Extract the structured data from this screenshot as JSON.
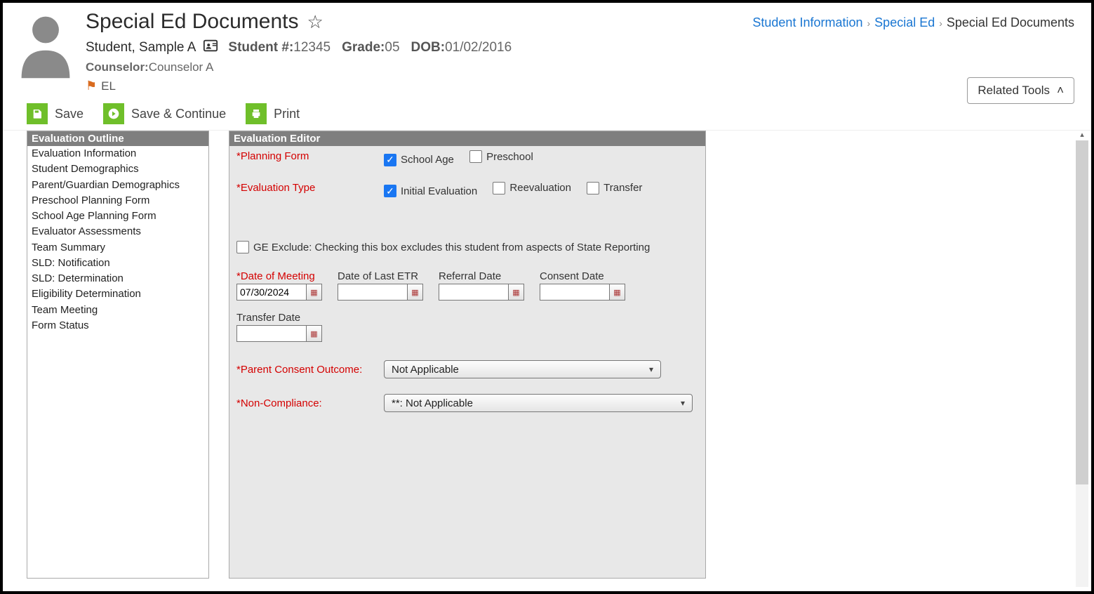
{
  "page": {
    "title": "Special Ed Documents"
  },
  "breadcrumb": {
    "a": "Student Information",
    "b": "Special Ed",
    "c": "Special Ed Documents"
  },
  "student": {
    "name": "Student, Sample A",
    "number_label": "Student #:",
    "number": "12345",
    "grade_label": "Grade:",
    "grade": "05",
    "dob_label": "DOB:",
    "dob": "01/02/2016",
    "counselor_label": "Counselor:",
    "counselor": "Counselor A",
    "flag": "EL"
  },
  "toolbar": {
    "save": "Save",
    "save_continue": "Save & Continue",
    "print": "Print",
    "related_tools": "Related Tools"
  },
  "outline": {
    "header": "Evaluation Outline",
    "items": [
      "Evaluation Information",
      "Student Demographics",
      "Parent/Guardian Demographics",
      "Preschool Planning Form",
      "School Age Planning Form",
      "Evaluator Assessments",
      "Team Summary",
      "SLD: Notification",
      "SLD: Determination",
      "Eligibility Determination",
      "Team Meeting",
      "Form Status"
    ]
  },
  "editor": {
    "header": "Evaluation Editor",
    "planning_form_label": "*Planning Form",
    "planning_opts": {
      "school_age": "School Age",
      "preschool": "Preschool"
    },
    "eval_type_label": "*Evaluation Type",
    "eval_opts": {
      "initial": "Initial Evaluation",
      "reeval": "Reevaluation",
      "transfer": "Transfer"
    },
    "ge_exclude": "GE Exclude: Checking this box excludes this student from aspects of State Reporting",
    "dates": {
      "meeting_label": "*Date of Meeting",
      "meeting_value": "07/30/2024",
      "last_etr_label": "Date of Last ETR",
      "referral_label": "Referral Date",
      "consent_label": "Consent Date",
      "transfer_label": "Transfer Date"
    },
    "parent_consent_label": "*Parent Consent Outcome:",
    "parent_consent_value": "Not Applicable",
    "noncompliance_label": "*Non-Compliance:",
    "noncompliance_value": "**: Not Applicable"
  }
}
